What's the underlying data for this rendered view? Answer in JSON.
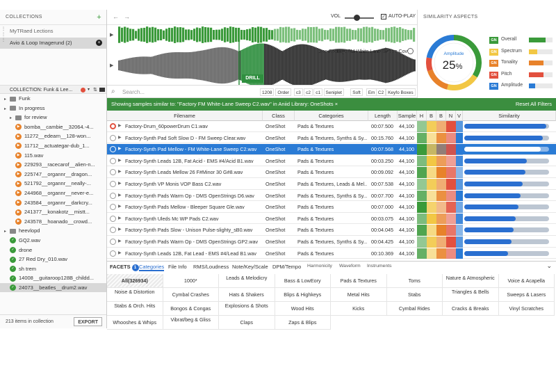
{
  "collections": {
    "header": "COLLECTIONS",
    "add_icon": "plus-icon",
    "muted_item": "MyTRaed Lections",
    "selected_item": "Avio & Loop Imagerund (2)",
    "bar_label": "COLLECTION: Funk & Lee..."
  },
  "tree": [
    {
      "label": "Funk",
      "type": "folder",
      "indent": 0
    },
    {
      "label": "In progress",
      "type": "folder",
      "indent": 0
    },
    {
      "label": "for review",
      "type": "folder",
      "indent": 1
    },
    {
      "label": "bomba__cambie__32064.-4...",
      "type": "orange",
      "indent": 2
    },
    {
      "label": "11272__edearn__128-won...",
      "type": "orange",
      "indent": 2
    },
    {
      "label": "11712__actuategar-dub_1...",
      "type": "orange",
      "indent": 2
    },
    {
      "label": "115.wav",
      "type": "orange",
      "indent": 2
    },
    {
      "label": "229293__racecarof__alien-n...",
      "type": "orange",
      "indent": 2
    },
    {
      "label": "225747__organnr__dragon...",
      "type": "orange",
      "indent": 2
    },
    {
      "label": "521792__organnr__neally-...",
      "type": "orange",
      "indent": 2
    },
    {
      "label": "244968__organnr__never-e...",
      "type": "orange",
      "indent": 2
    },
    {
      "label": "243584__organnr__darkcry...",
      "type": "orange",
      "indent": 2
    },
    {
      "label": "241377__konakotz__mistt...",
      "type": "orange",
      "indent": 2
    },
    {
      "label": "243578__hoanado__crowd...",
      "type": "orange",
      "indent": 2
    },
    {
      "label": "heevlopd",
      "type": "folder",
      "indent": 0
    },
    {
      "label": "GQ2.wav",
      "type": "green",
      "indent": 1
    },
    {
      "label": "drone",
      "type": "green",
      "indent": 1
    },
    {
      "label": "27 Red Dry_010.wav",
      "type": "green",
      "indent": 1
    },
    {
      "label": "sh trem",
      "type": "green",
      "indent": 1
    },
    {
      "label": "14008__guitaroop128B_childd...",
      "type": "green",
      "indent": 1
    },
    {
      "label": "24073__beatles__drum2.wav",
      "type": "green",
      "indent": 1,
      "selected": true
    }
  ],
  "left_footer": {
    "count": "213 items in collection",
    "export": "EXPORT"
  },
  "topbar": {
    "vol_label": "VOL",
    "autoplay_label": "AUTO-PLAY",
    "autoplay_check": "✓",
    "back_arrow": "←",
    "fwd_arrow": "→"
  },
  "waveform": {
    "label": "Gen Factory: FM White-Lane Sweep Cov",
    "drill": "DRILL"
  },
  "search": {
    "placeholder": "Search...",
    "chips": [
      "1208",
      "Order",
      "c3",
      "c2",
      "c1",
      "Seniplet",
      "Soft",
      "Em",
      "C2",
      "Keyfo Boxes"
    ]
  },
  "aspects": {
    "header": "SIMILARITY ASPECTS",
    "center_label": "Amplitude",
    "center_value": "25",
    "center_unit": "%",
    "items": [
      {
        "badge": "GN",
        "name": "Overall",
        "color": "#3a9a3a",
        "fill": 0.72
      },
      {
        "badge": "GN",
        "name": "Spectrum",
        "color": "#f2c744",
        "fill": 0.35
      },
      {
        "badge": "GN",
        "name": "Tonality",
        "color": "#e8822a",
        "fill": 0.62
      },
      {
        "badge": "GN",
        "name": "Pitch",
        "color": "#e2503e",
        "fill": 0.62
      },
      {
        "badge": "GN",
        "name": "Amplitude",
        "color": "#2a7bd5",
        "fill": 0.25
      }
    ]
  },
  "filterbar": {
    "text": "Showing samples similar to: \"Factory FM White-Lane Sweep C2.wav\" in Aniid Library: OneShots ×",
    "reset": "Reset All Filters"
  },
  "table": {
    "headers": {
      "filename": "Filename",
      "class": "Class",
      "categories": "Categories",
      "length": "Length",
      "samplerate": "Sample",
      "h": "H",
      "b1": "B",
      "b2": "B",
      "n": "N",
      "v": "V",
      "similarity": "Similarity"
    },
    "heat_colors": [
      "#3a9a3a",
      "#f2c744",
      "#e8822a",
      "#e2503e",
      "#2a7bd5"
    ],
    "rows": [
      {
        "filename": "Factory-Drum_60powerDrum C1.wav",
        "class": "OneShot",
        "categories": "Pads & Textures",
        "length": "00:07.500",
        "rate": "44,100",
        "sim": 0.97
      },
      {
        "filename": "Factory-Synth Pad Soft Slow D  -  FM Sweep Clear.wav",
        "class": "OneShot",
        "categories": "Pads & Textures, Synths & Sy...",
        "length": "00:15.760",
        "rate": "44,100",
        "sim": 0.93
      },
      {
        "filename": "Factory-Synth Pad Mellow  -  FM White-Lane Sweep C2.wav",
        "class": "OneShot",
        "categories": "Pads & Textures",
        "length": "00:07.568",
        "rate": "44,100",
        "sim": 0.9,
        "selected": true
      },
      {
        "filename": "Factory-Synth Leads 12B, Fat Acid  -  EMS #4/Acid B1.wav",
        "class": "OneShot",
        "categories": "Pads & Textures",
        "length": "00:03.250",
        "rate": "44,100",
        "sim": 0.74
      },
      {
        "filename": "Factory-Synth Leads Mellow 26 F#Minor 30 G#8.wav",
        "class": "OneShot",
        "categories": "Pads & Textures",
        "length": "00:09.092",
        "rate": "44,100",
        "sim": 0.72
      },
      {
        "filename": "Factory-Synth VP Monis  VOP Bass C2.wav",
        "class": "OneShot",
        "categories": "Pads & Textures, Leads & Mel...",
        "length": "00:07.538",
        "rate": "44,100",
        "sim": 0.69
      },
      {
        "filename": "Factory-Synth Pads Warm Op  -  DMS OpenStrings D6.wav",
        "class": "OneShot",
        "categories": "Pads & Textures, Synths & Sy...",
        "length": "00:07.700",
        "rate": "44,100",
        "sim": 0.66
      },
      {
        "filename": "Factory-Synth Pads Mellow  -  Bleeper Square Gle.wav",
        "class": "OneShot",
        "categories": "Pads & Textures",
        "length": "00:07.000",
        "rate": "44,100",
        "sim": 0.64
      },
      {
        "filename": "Factory-Synth Uleds Mc WP Pads C2.wav",
        "class": "OneShot",
        "categories": "Pads & Textures",
        "length": "00:03.075",
        "rate": "44,100",
        "sim": 0.61
      },
      {
        "filename": "Factory-Synth Pads Slow  -  Unison Pulse-slighty_sB0.wav",
        "class": "OneShot",
        "categories": "Pads & Textures",
        "length": "00:04.045",
        "rate": "44,100",
        "sim": 0.58
      },
      {
        "filename": "Factory-Synth Pads Warm Op  -  DMS OpenStrings GP2.wav",
        "class": "OneShot",
        "categories": "Pads & Textures, Synths & Sy...",
        "length": "00:04.425",
        "rate": "44,100",
        "sim": 0.56
      },
      {
        "filename": "Factory-Synth Leads 12B, Fat Lead  -  EMS #4/Lead B1.wav",
        "class": "OneShot",
        "categories": "Pads & Textures",
        "length": "00:10.369",
        "rate": "44,100",
        "sim": 0.52
      }
    ]
  },
  "facets": {
    "tabs": [
      "FACETS",
      "Categories",
      "File Info",
      "RMS/Loudness",
      "Note/Key/Scale",
      "DPM/Tempo",
      "Harmonicity",
      "Waveform",
      "Instruments"
    ],
    "badge": "1",
    "grid": [
      [
        "All(326934)",
        "1000*",
        "Leads & Melodicry",
        "Bass & LowEory",
        "Pads & Textures",
        "Toms",
        "Nature & Atmospheric",
        "Voice & Acapella"
      ],
      [
        "Noise & Distortion",
        "Cymbal Crashes",
        "Hats & Shakers",
        "Blips & Highkeys",
        "Metal Hits",
        "Stabs",
        "Triangles & Bells",
        "Sweeps & Lasers"
      ],
      [
        "Stabs & Orch. Hits",
        "Bongos & Congas",
        "Explosions & Shots",
        "Wood Hits",
        "Kicks",
        "Cymbal Rides",
        "Cracks & Breaks",
        "Vinyl Scratches"
      ],
      [
        "Whooshes & Whips",
        "Vibrat/beg & Gliss",
        "Claps",
        "Zaps & Blips",
        "",
        "",
        "",
        ""
      ]
    ]
  }
}
